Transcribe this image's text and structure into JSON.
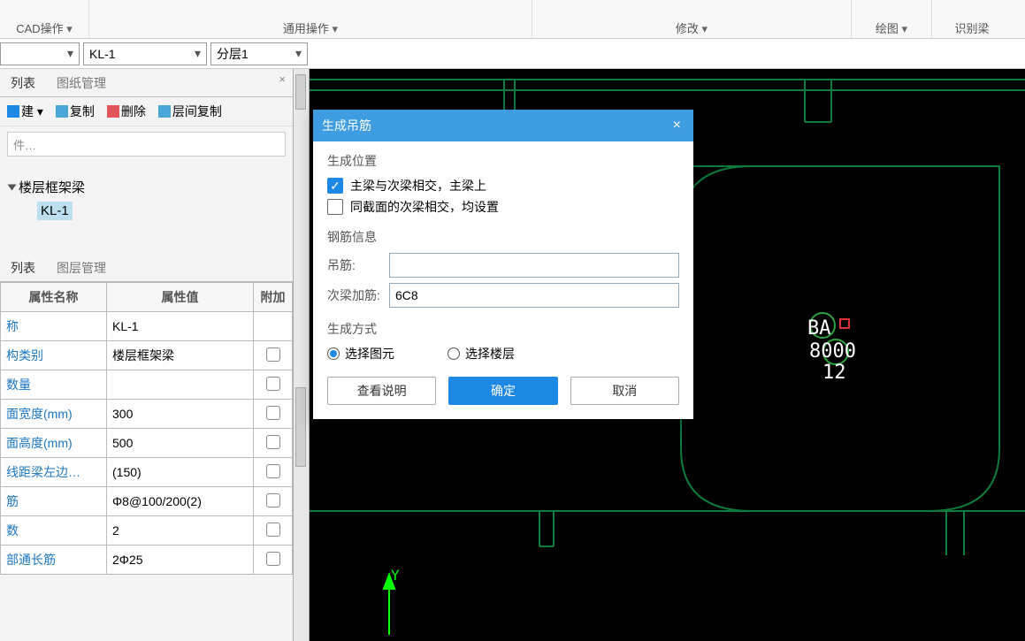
{
  "ribbon": {
    "groups": [
      {
        "label": "CAD操作"
      },
      {
        "label": "通用操作"
      },
      {
        "label": "修改"
      },
      {
        "label": "绘图"
      },
      {
        "label": "识别梁"
      }
    ]
  },
  "dropdowns": [
    {
      "value": ""
    },
    {
      "value": "KL-1"
    },
    {
      "value": "分层1"
    }
  ],
  "list_panel": {
    "tabs": [
      "列表",
      "图纸管理"
    ],
    "active_tab": 0,
    "toolbar": {
      "new": "建",
      "copy": "复制",
      "delete": "删除",
      "layer_copy": "层间复制"
    },
    "search_placeholder": "件…",
    "tree": {
      "root": "楼层框架梁",
      "child": "KL-1"
    }
  },
  "prop_panel": {
    "tabs": [
      "列表",
      "图层管理"
    ],
    "active_tab": 0,
    "headers": [
      "属性名称",
      "属性值",
      "附加"
    ],
    "rows": [
      {
        "name": "称",
        "value": "KL-1",
        "ck": false,
        "name_blue": true
      },
      {
        "name": "构类别",
        "value": "楼层框架梁",
        "ck": true,
        "name_blue": true
      },
      {
        "name": "数量",
        "value": "",
        "ck": true,
        "name_blue": true
      },
      {
        "name": "面宽度(mm)",
        "value": "300",
        "ck": true,
        "name_blue": true
      },
      {
        "name": "面高度(mm)",
        "value": "500",
        "ck": true,
        "name_blue": true
      },
      {
        "name": "线距梁左边…",
        "value": "(150)",
        "ck": true,
        "name_blue": true
      },
      {
        "name": "筋",
        "value": "Φ8@100/200(2)",
        "ck": true,
        "name_blue": true
      },
      {
        "name": "数",
        "value": "2",
        "ck": true,
        "name_blue": true
      },
      {
        "name": "部通长筋",
        "value": "2Φ25",
        "ck": true,
        "name_blue": true
      }
    ]
  },
  "dialog": {
    "title": "生成吊筋",
    "sections": {
      "position_title": "生成位置",
      "chk1": "主梁与次梁相交，主梁上",
      "chk2": "同截面的次梁相交，均设置",
      "rebar_title": "钢筋信息",
      "diao": {
        "label": "吊筋:",
        "value": ""
      },
      "ci": {
        "label": "次梁加筋:",
        "value": "6C8"
      },
      "mode_title": "生成方式",
      "radio1": "选择图元",
      "radio2": "选择楼层"
    },
    "buttons": {
      "help": "查看说明",
      "ok": "确定",
      "cancel": "取消"
    }
  },
  "canvas": {
    "axis_label_y": "Y",
    "text1": "BA",
    "text2": "8000",
    "text3": "12"
  }
}
